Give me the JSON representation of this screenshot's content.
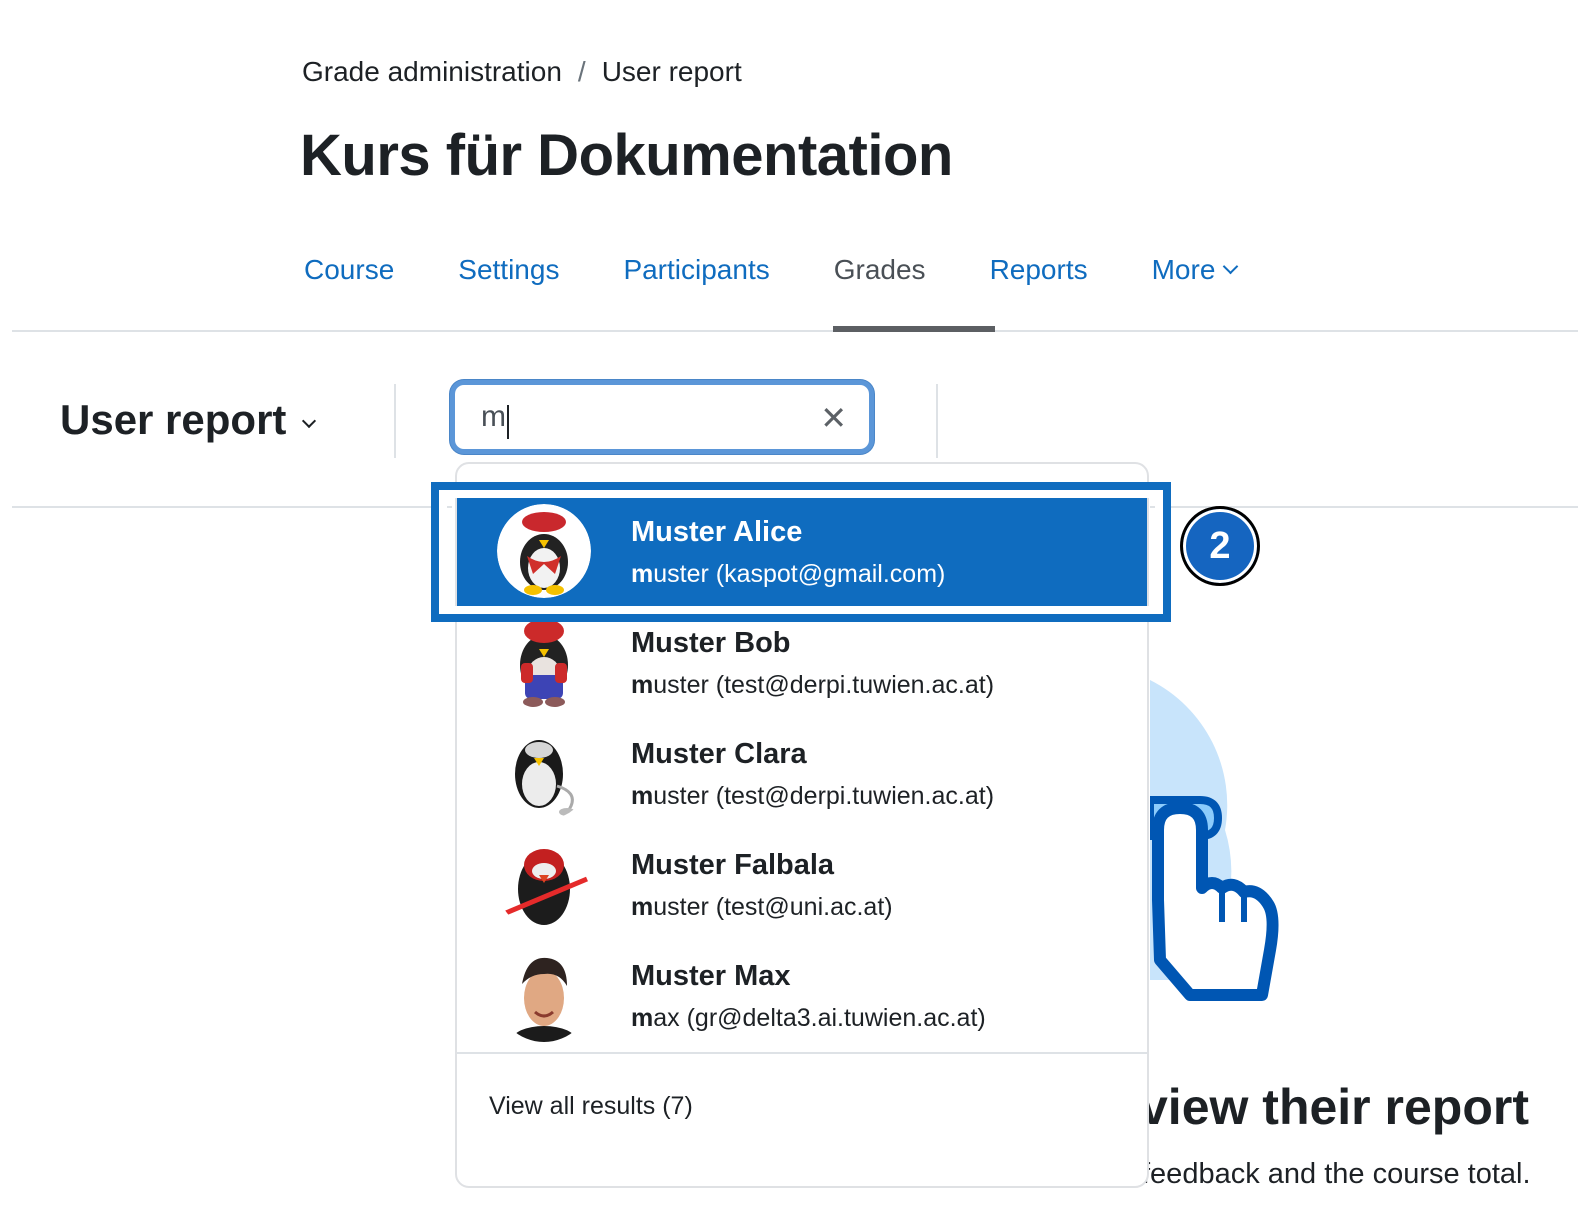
{
  "breadcrumb": {
    "items": [
      "Grade administration",
      "User report"
    ],
    "separator": "/"
  },
  "page_title": "Kurs für Dokumentation",
  "nav": {
    "tabs": [
      {
        "label": "Course",
        "active": false
      },
      {
        "label": "Settings",
        "active": false
      },
      {
        "label": "Participants",
        "active": false
      },
      {
        "label": "Grades",
        "active": true
      },
      {
        "label": "Reports",
        "active": false
      },
      {
        "label": "More",
        "active": false,
        "has_dropdown": true
      }
    ]
  },
  "report_selector": {
    "label": "User report",
    "icon": "chevron-down-icon"
  },
  "search": {
    "value": "m",
    "clear_icon": "close-icon",
    "clear_glyph": "✕"
  },
  "results": [
    {
      "name": "Muster Alice",
      "match": "m",
      "rest": "uster (kaspot@gmail.com)",
      "avatar": "penguin-beret",
      "selected": true
    },
    {
      "name": "Muster Bob",
      "match": "m",
      "rest": "uster (test@derpi.tuwien.ac.at)",
      "avatar": "penguin-mario",
      "selected": false
    },
    {
      "name": "Muster Clara",
      "match": "m",
      "rest": "uster (test@derpi.tuwien.ac.at)",
      "avatar": "penguin-ipod",
      "selected": false
    },
    {
      "name": "Muster Falbala",
      "match": "m",
      "rest": "uster (test@uni.ac.at)",
      "avatar": "penguin-sith",
      "selected": false
    },
    {
      "name": "Muster Max",
      "match": "m",
      "rest": "ax (gr@delta3.ai.tuwien.ac.at)",
      "avatar": "photo-man",
      "selected": false
    }
  ],
  "view_all": "View all results (7)",
  "step_badge": "2",
  "empty_state": {
    "heading_visible": "view their report",
    "text_visible": "feedback and the course total."
  },
  "colors": {
    "primary": "#0f6cbf",
    "selected_bg": "#0f6cbf",
    "focus_ring": "#5b96d8",
    "text": "#1d2125",
    "illustration_light": "#c8e4fb",
    "illustration_dark": "#0056b3"
  }
}
